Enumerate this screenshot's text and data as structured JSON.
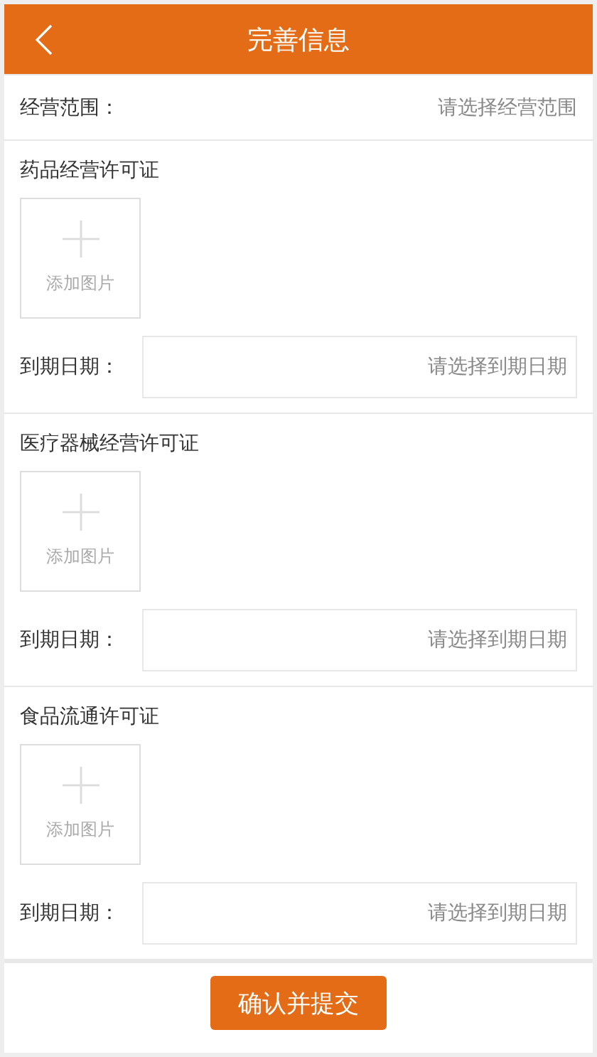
{
  "header": {
    "title": "完善信息"
  },
  "scope": {
    "label": "经营范围：",
    "placeholder": "请选择经营范围"
  },
  "licenses": [
    {
      "title": "药品经营许可证",
      "upload_label": "添加图片",
      "date_label": "到期日期：",
      "date_placeholder": "请选择到期日期"
    },
    {
      "title": "医疗器械经营许可证",
      "upload_label": "添加图片",
      "date_label": "到期日期：",
      "date_placeholder": "请选择到期日期"
    },
    {
      "title": "食品流通许可证",
      "upload_label": "添加图片",
      "date_label": "到期日期：",
      "date_placeholder": "请选择到期日期"
    }
  ],
  "submit": "确认并提交"
}
